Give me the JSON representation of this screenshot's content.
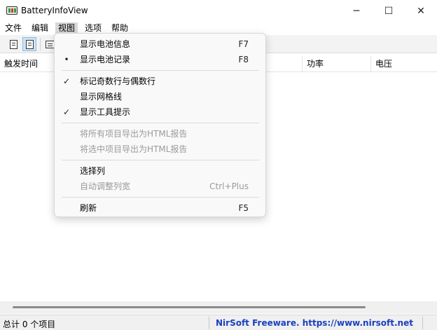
{
  "window": {
    "title": "BatteryInfoView",
    "minimize_icon": "minimize-icon",
    "maximize_icon": "maximize-icon",
    "close_icon": "close-icon",
    "minimize_glyph": "─",
    "maximize_glyph": "☐",
    "close_glyph": "✕"
  },
  "menubar": [
    "文件",
    "编辑",
    "视图",
    "选项",
    "帮助"
  ],
  "toolbar": {
    "buttons": [
      "battery-info-icon",
      "battery-log-icon",
      "window-icon"
    ]
  },
  "columns": [
    "触发时间",
    "功率",
    "电压"
  ],
  "view_menu": {
    "items": [
      {
        "label": "显示电池信息",
        "accel": "F7",
        "mark": "",
        "enabled": true
      },
      {
        "label": "显示电池记录",
        "accel": "F8",
        "mark": "•",
        "enabled": true
      },
      {
        "label": "标记奇数行与偶数行",
        "accel": "",
        "mark": "✓",
        "enabled": true
      },
      {
        "label": "显示网格线",
        "accel": "",
        "mark": "",
        "enabled": true
      },
      {
        "label": "显示工具提示",
        "accel": "",
        "mark": "✓",
        "enabled": true
      },
      {
        "label": "将所有项目导出为HTML报告",
        "accel": "",
        "mark": "",
        "enabled": false
      },
      {
        "label": "将选中项目导出为HTML报告",
        "accel": "",
        "mark": "",
        "enabled": false
      },
      {
        "label": "选择列",
        "accel": "",
        "mark": "",
        "enabled": true
      },
      {
        "label": "自动调整列宽",
        "accel": "Ctrl+Plus",
        "mark": "",
        "enabled": false
      },
      {
        "label": "刷新",
        "accel": "F5",
        "mark": "",
        "enabled": true
      }
    ]
  },
  "status": {
    "count": "总计 0 个项目",
    "credit": "NirSoft Freeware. https://www.nirsoft.net"
  },
  "colors": {
    "credit_link": "#1a3fbf",
    "menu_highlight": "#d9d9d9",
    "pressed_button": "#cce4f7"
  }
}
